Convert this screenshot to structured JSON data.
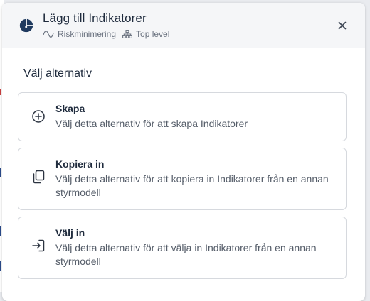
{
  "dialog": {
    "title": "Lägg till Indikatorer",
    "meta": {
      "category_label": "Riskminimering",
      "level_label": "Top level"
    },
    "close_label": "×"
  },
  "section": {
    "heading": "Välj alternativ"
  },
  "options": [
    {
      "title": "Skapa",
      "description": "Välj detta alternativ för att skapa Indikatorer",
      "icon": "plus-circle-icon"
    },
    {
      "title": "Kopiera in",
      "description": "Välj detta alternativ för att kopiera in Indikatorer från en annan styrmodell",
      "icon": "copy-icon"
    },
    {
      "title": "Välj in",
      "description": "Välj detta alternativ för att välja in Indikatorer från en annan styrmodell",
      "icon": "import-arrow-icon"
    }
  ],
  "colors": {
    "text_primary": "#1f2b3d",
    "text_secondary": "#555d69",
    "header_bg": "#f5f6f8",
    "border": "#d6d9de"
  }
}
